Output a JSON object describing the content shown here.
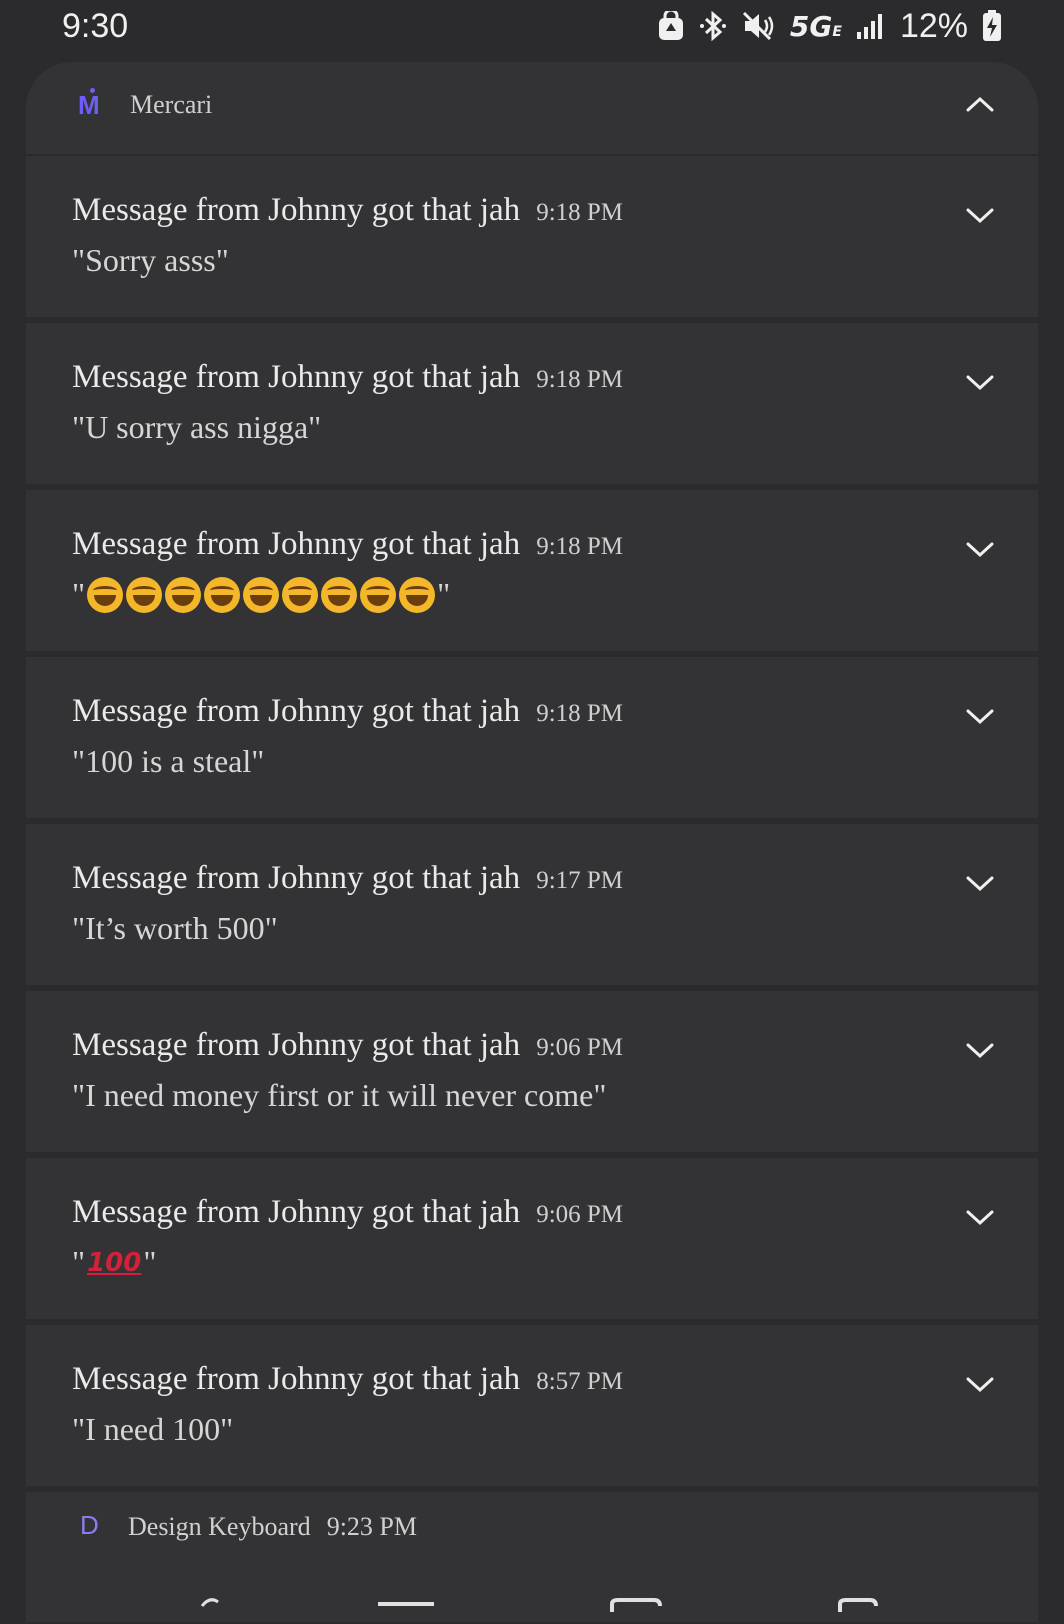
{
  "status_bar": {
    "time": "9:30",
    "network": "5G",
    "network_sub": "E",
    "battery": "12%",
    "icons": [
      "recycle-lock-icon",
      "bluetooth-icon",
      "mute-icon",
      "signal-icon",
      "battery-charging-icon"
    ]
  },
  "app_group": {
    "app_name": "Mercari",
    "icon": "mercari-logo-icon",
    "accent_color": "#6d5ff5"
  },
  "notifications": [
    {
      "title": "Message from Johnny got that jah",
      "time": "9:18 PM",
      "body": "\"Sorry asss\""
    },
    {
      "title": "Message from Johnny got that jah",
      "time": "9:18 PM",
      "body": "\"U sorry ass nigga\""
    },
    {
      "title": "Message from Johnny got that jah",
      "time": "9:18 PM",
      "body_prefix": "\"",
      "body_suffix": "\"",
      "emoji": "laughing-face-icon",
      "emoji_count": 9
    },
    {
      "title": "Message from Johnny got that jah",
      "time": "9:18 PM",
      "body": "\"100 is a steal\""
    },
    {
      "title": "Message from Johnny got that jah",
      "time": "9:17 PM",
      "body": "\"It’s worth 500\""
    },
    {
      "title": "Message from Johnny got that jah",
      "time": "9:06 PM",
      "body": "\"I need money first or it will never come\""
    },
    {
      "title": "Message from Johnny got that jah",
      "time": "9:06 PM",
      "body_prefix": "\"",
      "body_suffix": "\"",
      "emoji": "hundred-points-icon",
      "emoji_text": "100"
    },
    {
      "title": "Message from Johnny got that jah",
      "time": "8:57 PM",
      "body": "\"I need 100\""
    }
  ],
  "second_app": {
    "icon_letter": "D",
    "app_name": "Design Keyboard",
    "time": "9:23 PM"
  }
}
